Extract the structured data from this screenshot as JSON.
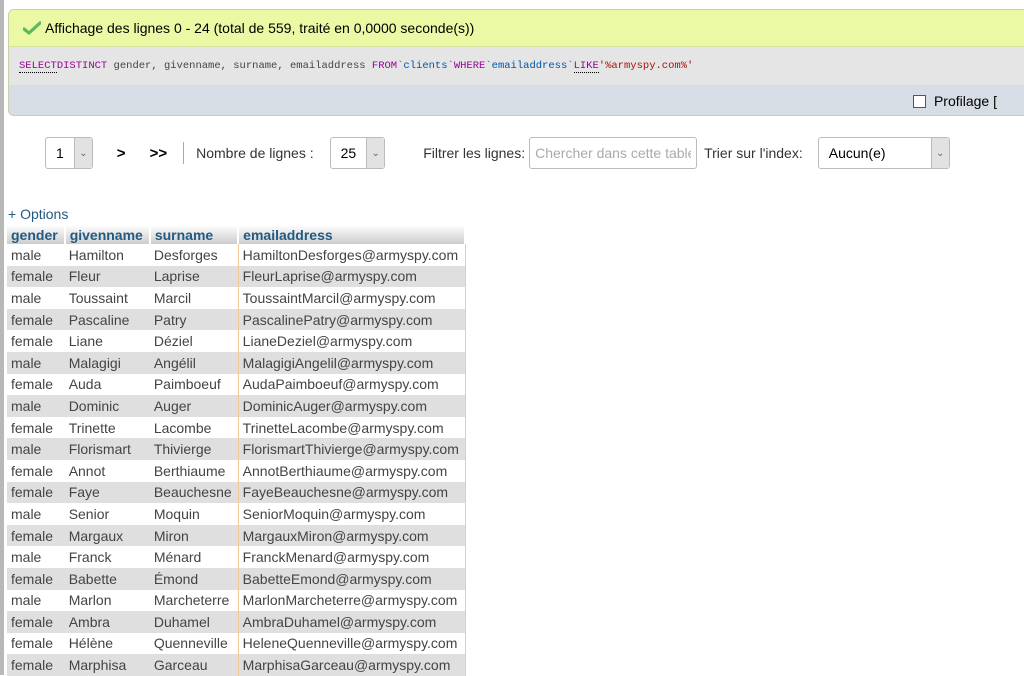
{
  "status": {
    "icon": "check-icon",
    "message": "Affichage des lignes 0 - 24 (total de 559, traité en 0,0000 seconde(s))"
  },
  "sql": {
    "kw_select": "SELECT",
    "kw_distinct": "DISTINCT",
    "columns": " gender, givenname, surname, emailaddress ",
    "kw_from": "FROM",
    "table": "`clients`",
    "kw_where": "WHERE",
    "column": "`emailaddress`",
    "kw_like": "LIKE",
    "pattern": "'%armyspy.com%'"
  },
  "profiling": {
    "label": "Profilage [",
    "checked": false
  },
  "navigation": {
    "page_value": "1",
    "next_label": ">",
    "last_label": ">>",
    "rows_label": "Nombre de lignes :",
    "rows_value": "25",
    "filter_label": "Filtrer les lignes:",
    "filter_placeholder": "Chercher dans cette table",
    "filter_value": "",
    "sort_label": "Trier sur l'index:",
    "sort_value": "Aucun(e)"
  },
  "options_link": "+ Options",
  "table": {
    "columns": [
      "gender",
      "givenname",
      "surname",
      "emailaddress"
    ],
    "rows": [
      [
        "male",
        "Hamilton",
        "Desforges",
        "HamiltonDesforges@armyspy.com"
      ],
      [
        "female",
        "Fleur",
        "Laprise",
        "FleurLaprise@armyspy.com"
      ],
      [
        "male",
        "Toussaint",
        "Marcil",
        "ToussaintMarcil@armyspy.com"
      ],
      [
        "female",
        "Pascaline",
        "Patry",
        "PascalinePatry@armyspy.com"
      ],
      [
        "female",
        "Liane",
        "Déziel",
        "LianeDeziel@armyspy.com"
      ],
      [
        "male",
        "Malagigi",
        "Angélil",
        "MalagigiAngelil@armyspy.com"
      ],
      [
        "female",
        "Auda",
        "Paimboeuf",
        "AudaPaimboeuf@armyspy.com"
      ],
      [
        "male",
        "Dominic",
        "Auger",
        "DominicAuger@armyspy.com"
      ],
      [
        "female",
        "Trinette",
        "Lacombe",
        "TrinetteLacombe@armyspy.com"
      ],
      [
        "male",
        "Florismart",
        "Thivierge",
        "FlorismartThivierge@armyspy.com"
      ],
      [
        "female",
        "Annot",
        "Berthiaume",
        "AnnotBerthiaume@armyspy.com"
      ],
      [
        "female",
        "Faye",
        "Beauchesne",
        "FayeBeauchesne@armyspy.com"
      ],
      [
        "male",
        "Senior",
        "Moquin",
        "SeniorMoquin@armyspy.com"
      ],
      [
        "female",
        "Margaux",
        "Miron",
        "MargauxMiron@armyspy.com"
      ],
      [
        "male",
        "Franck",
        "Ménard",
        "FranckMenard@armyspy.com"
      ],
      [
        "female",
        "Babette",
        "Émond",
        "BabetteEmond@armyspy.com"
      ],
      [
        "male",
        "Marlon",
        "Marcheterre",
        "MarlonMarcheterre@armyspy.com"
      ],
      [
        "female",
        "Ambra",
        "Duhamel",
        "AmbraDuhamel@armyspy.com"
      ],
      [
        "female",
        "Hélène",
        "Quenneville",
        "HeleneQuenneville@armyspy.com"
      ],
      [
        "female",
        "Marphisa",
        "Garceau",
        "MarphisaGarceau@armyspy.com"
      ]
    ]
  }
}
